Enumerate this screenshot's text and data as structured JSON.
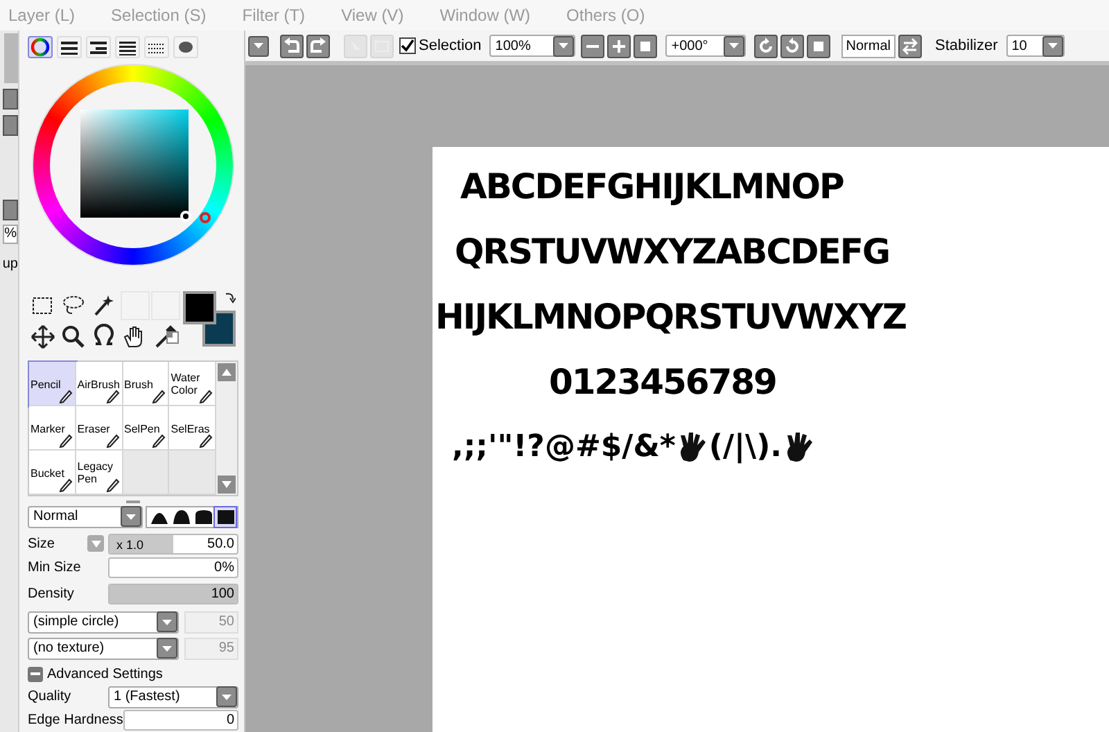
{
  "menu": [
    {
      "label": "Layer (L)"
    },
    {
      "label": "Selection (S)"
    },
    {
      "label": "Filter (T)"
    },
    {
      "label": "View (V)"
    },
    {
      "label": "Window (W)"
    },
    {
      "label": "Others (O)"
    }
  ],
  "side_strip": {
    "texts": [
      "%",
      "up"
    ]
  },
  "color_tabs": [
    {
      "selected": true
    },
    {
      "selected": false
    },
    {
      "selected": false
    },
    {
      "selected": false
    },
    {
      "selected": false
    },
    {
      "selected": false
    }
  ],
  "toolbar": {
    "selection_checked": true,
    "selection_label": "Selection",
    "zoom": "100%",
    "rotation": "+000°",
    "blend": "Normal",
    "stabilizer_label": "Stabilizer",
    "stabilizer": "10"
  },
  "brushes": [
    {
      "label": "Pencil",
      "selected": true
    },
    {
      "label": "AirBrush",
      "selected": false
    },
    {
      "label": "Brush",
      "selected": false
    },
    {
      "label": "Water Color",
      "selected": false
    },
    {
      "label": "Marker",
      "selected": false
    },
    {
      "label": "Eraser",
      "selected": false
    },
    {
      "label": "SelPen",
      "selected": false
    },
    {
      "label": "SelEras",
      "selected": false
    },
    {
      "label": "Bucket",
      "selected": false
    },
    {
      "label": "Legacy Pen",
      "selected": false
    }
  ],
  "brush_settings": {
    "mode": "Normal",
    "shapes": [
      {
        "selected": false
      },
      {
        "selected": false
      },
      {
        "selected": false
      },
      {
        "selected": true
      }
    ],
    "size": {
      "label": "Size",
      "multiplier": "x 1.0",
      "value": "50.0",
      "level": 0.5
    },
    "min_size": {
      "label": "Min Size",
      "value": "0%",
      "level": 0
    },
    "density": {
      "label": "Density",
      "value": "100",
      "level": 1
    },
    "shape": {
      "value": "(simple circle)",
      "amount": "50",
      "disabled": true
    },
    "texture": {
      "value": "(no texture)",
      "amount": "95",
      "disabled": true
    },
    "advanced": {
      "label": "Advanced Settings",
      "expanded": true
    },
    "quality": {
      "label": "Quality",
      "value": "1 (Fastest)"
    },
    "edge_hardness": {
      "label": "Edge Hardness",
      "value": "0"
    }
  },
  "canvas": {
    "lines": [
      "ABCDEFGHIJKLMNOP",
      "QRSTUVWXYZABCDEFG",
      "HIJKLMNOPQRSTUVWXYZ",
      "0123456789"
    ],
    "symbols": [
      ",;;'\"!?@#$/&*",
      "(/|\\)."
    ]
  }
}
